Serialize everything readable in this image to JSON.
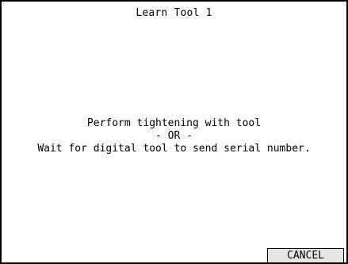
{
  "window": {
    "title": "Learn Tool 1"
  },
  "message": {
    "line1": "Perform tightening with tool",
    "line2": "- OR -",
    "line3": "Wait for digital tool to send serial number."
  },
  "actions": {
    "cancel_label": "CANCEL"
  }
}
